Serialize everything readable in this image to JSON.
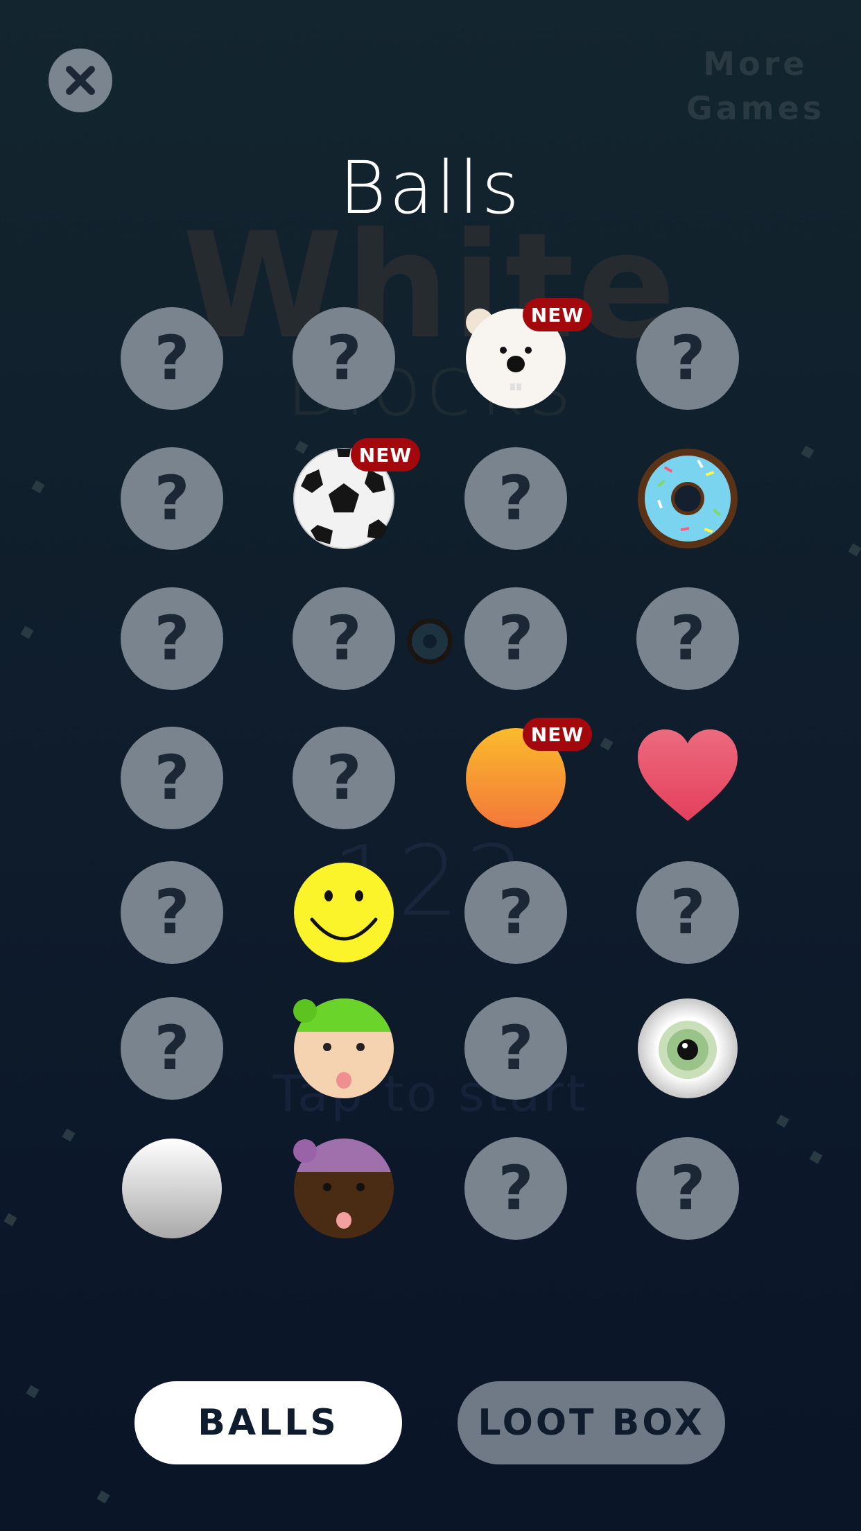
{
  "header": {
    "close_icon": "close-icon",
    "more_games_line1": "More",
    "more_games_line2": "Games",
    "title": "Balls"
  },
  "background": {
    "game_title_line1": "White",
    "game_title_line2": "Blocks",
    "score": "123",
    "hint": "Tap to start"
  },
  "grid": {
    "locked_symbol": "?",
    "new_badge": "NEW",
    "rows": [
      [
        "locked",
        "locked",
        "polar-bear",
        "locked"
      ],
      [
        "locked",
        "soccer-ball",
        "locked",
        "donut"
      ],
      [
        "locked",
        "locked",
        "locked",
        "locked"
      ],
      [
        "locked",
        "locked",
        "orange-ball",
        "heart"
      ],
      [
        "locked",
        "smiley",
        "locked",
        "locked"
      ],
      [
        "locked",
        "green-hat-face",
        "locked",
        "eyeball"
      ],
      [
        "white-ball",
        "purple-hat-face",
        "locked",
        "locked"
      ]
    ],
    "new_items": [
      "polar-bear",
      "soccer-ball",
      "orange-ball"
    ]
  },
  "tabs": {
    "balls_label": "BALLS",
    "loot_box_label": "LOOT BOX",
    "active": "balls"
  },
  "colors": {
    "locked_circle": "#7a848f",
    "new_badge": "#a3080c",
    "active_tab": "#ffffff",
    "inactive_tab": "#6f7a86"
  }
}
